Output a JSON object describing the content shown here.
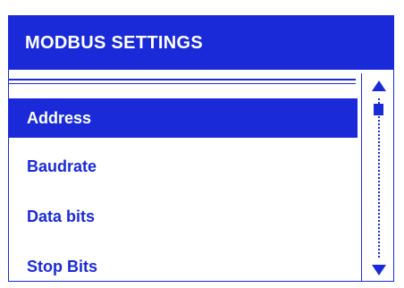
{
  "header": {
    "title": "MODBUS SETTINGS"
  },
  "menu": {
    "items": [
      {
        "label": "Address",
        "selected": true
      },
      {
        "label": "Baudrate",
        "selected": false
      },
      {
        "label": "Data bits",
        "selected": false
      },
      {
        "label": "Stop Bits",
        "selected": false
      }
    ]
  },
  "scrollbar": {
    "up_icon": "arrow-up-icon",
    "down_icon": "arrow-down-icon",
    "position_fraction": 0.0
  },
  "colors": {
    "accent": "#1a2ad8",
    "background": "#ffffff",
    "selected_text": "#ffffff"
  }
}
